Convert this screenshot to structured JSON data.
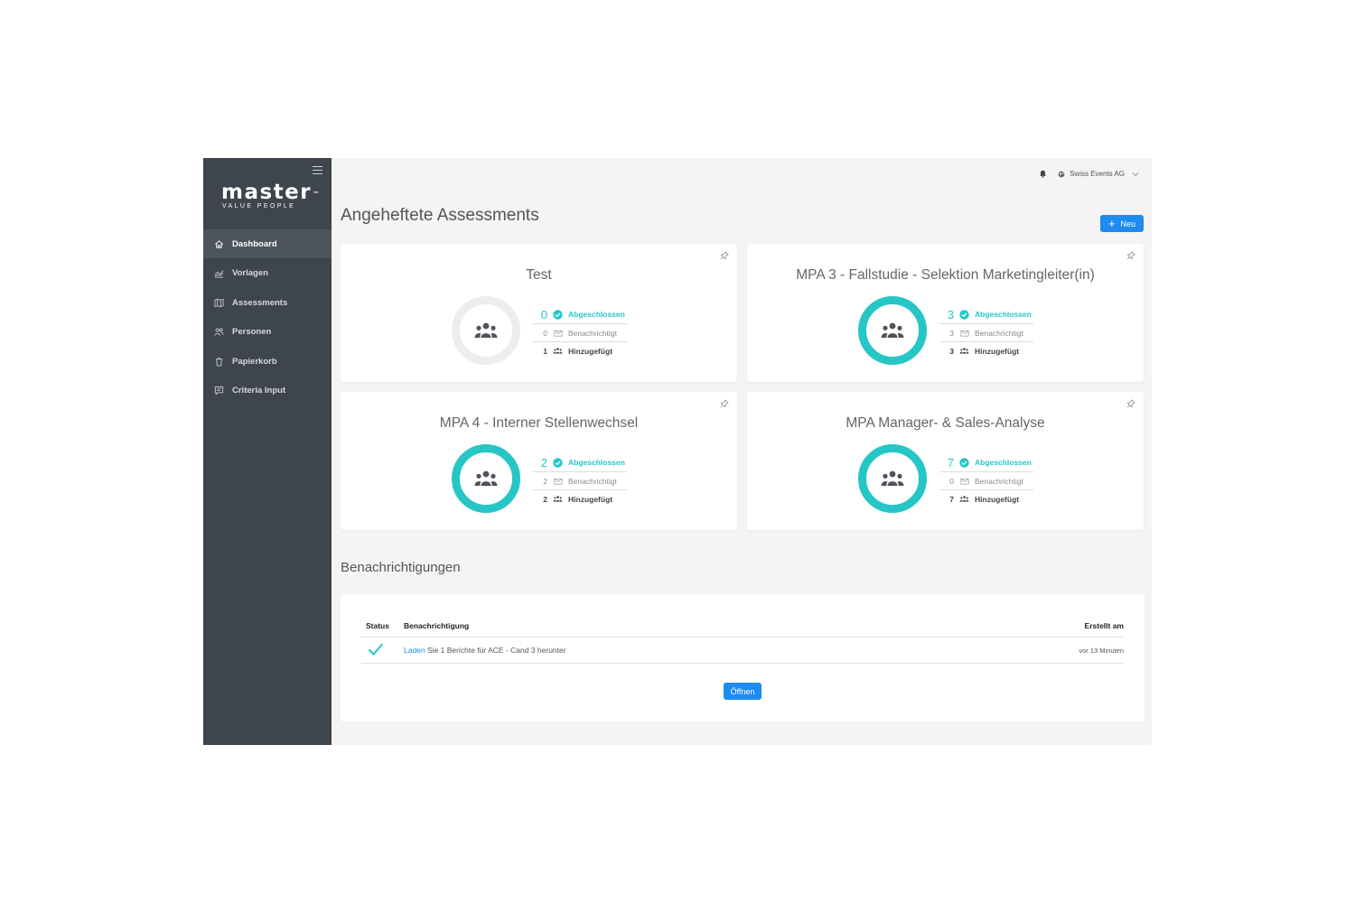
{
  "brand": {
    "name": "master",
    "tm": "™",
    "tagline": "VALUE PEOPLE"
  },
  "sidebar": {
    "items": [
      {
        "label": "Dashboard",
        "icon": "home-icon",
        "active": true
      },
      {
        "label": "Vorlagen",
        "icon": "chart-icon"
      },
      {
        "label": "Assessments",
        "icon": "map-icon"
      },
      {
        "label": "Personen",
        "icon": "users-icon"
      },
      {
        "label": "Papierkorb",
        "icon": "trash-icon"
      },
      {
        "label": "Criteria Input",
        "icon": "message-icon"
      }
    ]
  },
  "header": {
    "organization": "Swiss Events AG"
  },
  "pinned": {
    "title": "Angeheftete Assessments",
    "new_button": "Neu",
    "cards": [
      {
        "title": "Test",
        "completed": "0",
        "notified": "0",
        "added": "1"
      },
      {
        "title": "MPA 3 - Fallstudie - Selektion Marketingleiter(in)",
        "completed": "3",
        "notified": "3",
        "added": "3"
      },
      {
        "title": "MPA 4 - Interner Stellenwechsel",
        "completed": "2",
        "notified": "2",
        "added": "2"
      },
      {
        "title": "MPA Manager- & Sales-Analyse",
        "completed": "7",
        "notified": "0",
        "added": "7"
      }
    ],
    "labels": {
      "completed": "Abgeschlossen",
      "notified": "Benachrichtigt",
      "added": "Hinzugefügt"
    }
  },
  "notifications": {
    "title": "Benachrichtigungen",
    "columns": {
      "status": "Status",
      "message": "Benachrichtigung",
      "created": "Erstellt am"
    },
    "rows": [
      {
        "link": "Laden",
        "text": "Sie 1 Berichte für ACE - Cand 3 herunter",
        "created": "vor 13 Minuten"
      }
    ],
    "open_button": "Öffnen"
  },
  "colors": {
    "accent": "#26c6c6",
    "primary": "#1e8bf0",
    "sidebar": "#3e454d"
  }
}
